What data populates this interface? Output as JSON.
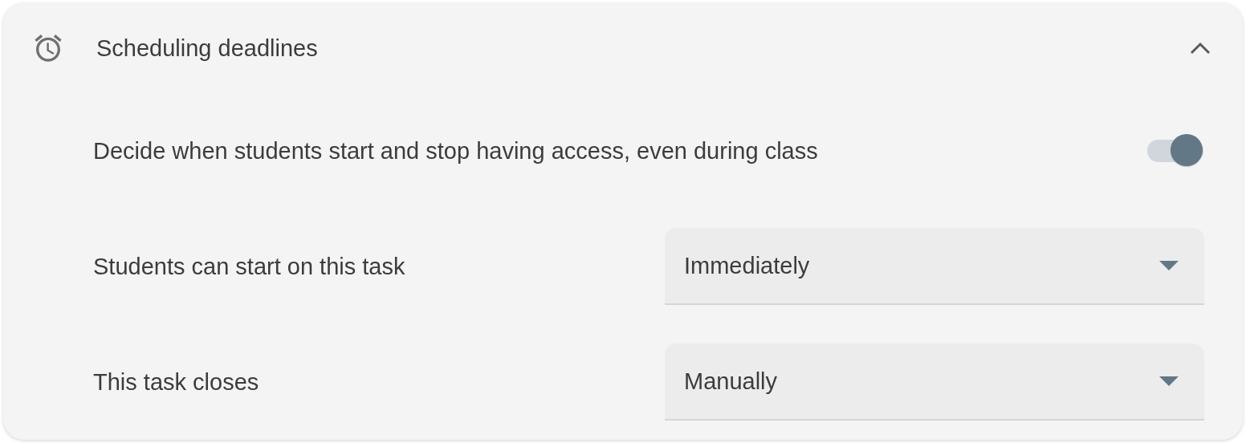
{
  "section": {
    "title": "Scheduling deadlines",
    "expanded": true
  },
  "access_toggle": {
    "label": "Decide when students start and stop having access, even during class",
    "on": true
  },
  "fields": [
    {
      "label": "Students can start on this task",
      "value": "Immediately"
    },
    {
      "label": "This task closes",
      "value": "Manually"
    }
  ]
}
